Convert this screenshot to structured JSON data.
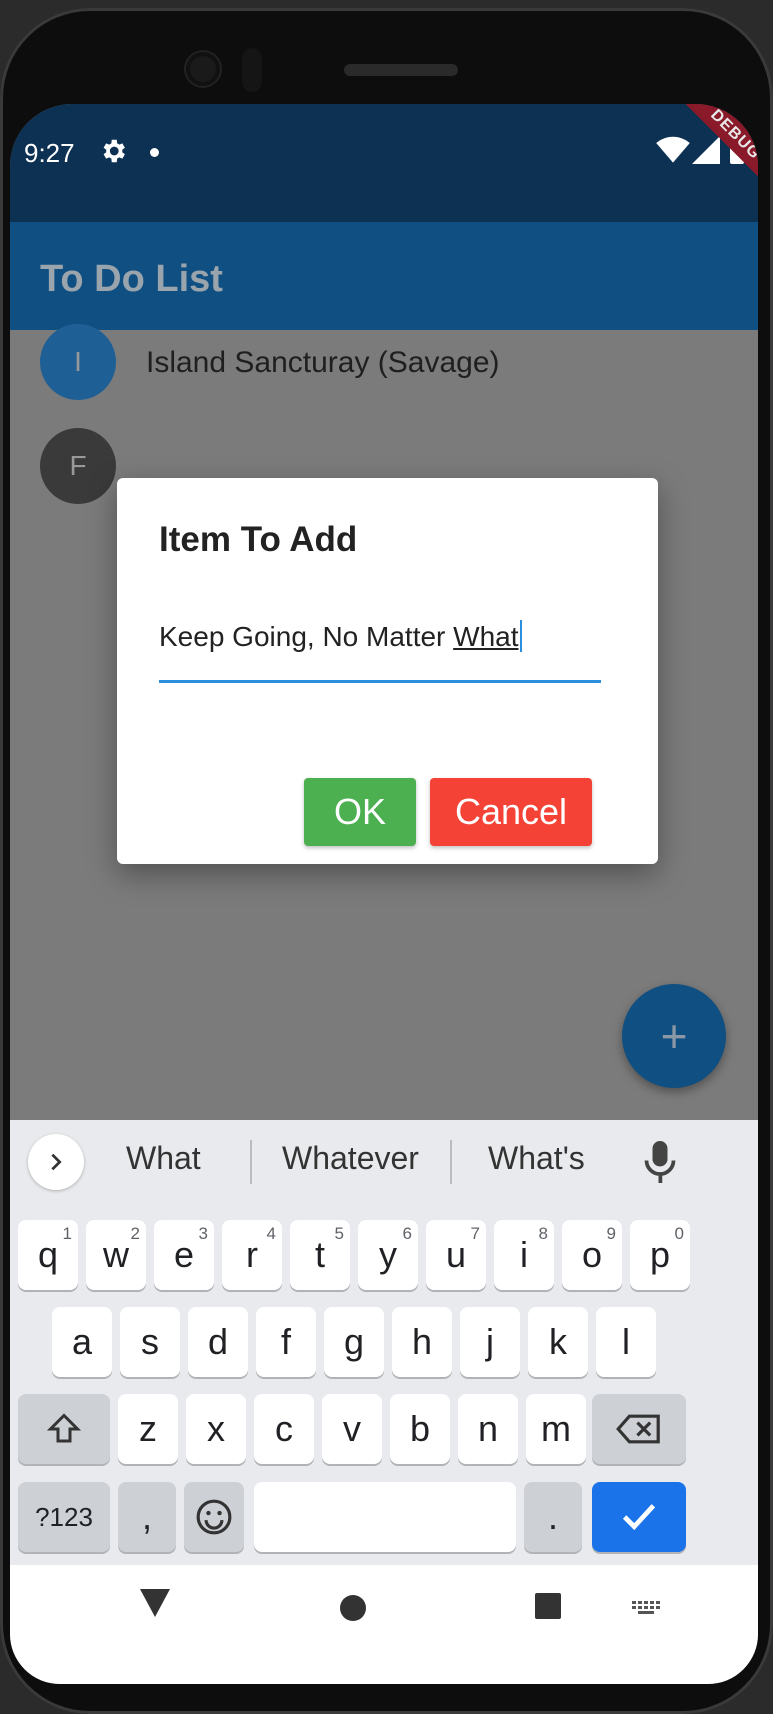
{
  "status_bar": {
    "time": "9:27",
    "debug_label": "DEBUG"
  },
  "app_bar": {
    "title": "To Do List"
  },
  "list": {
    "items": [
      {
        "initial": "I",
        "label": "Island Sancturay (Savage)",
        "avatar_color": "#1e5f96"
      },
      {
        "initial": "F",
        "label": "",
        "avatar_color": "#3a3a3a"
      }
    ]
  },
  "fab": {
    "label": "+"
  },
  "dialog": {
    "title": "Item To Add",
    "input_value_prefix": "Keep Going, No Matter ",
    "input_value_composing": "What",
    "ok_label": "OK",
    "cancel_label": "Cancel"
  },
  "keyboard": {
    "suggestions": [
      "What",
      "Whatever",
      "What's"
    ],
    "row1": [
      {
        "key": "q",
        "sup": "1"
      },
      {
        "key": "w",
        "sup": "2"
      },
      {
        "key": "e",
        "sup": "3"
      },
      {
        "key": "r",
        "sup": "4"
      },
      {
        "key": "t",
        "sup": "5"
      },
      {
        "key": "y",
        "sup": "6"
      },
      {
        "key": "u",
        "sup": "7"
      },
      {
        "key": "i",
        "sup": "8"
      },
      {
        "key": "o",
        "sup": "9"
      },
      {
        "key": "p",
        "sup": "0"
      }
    ],
    "row2": [
      "a",
      "s",
      "d",
      "f",
      "g",
      "h",
      "j",
      "k",
      "l"
    ],
    "row3": [
      "z",
      "x",
      "c",
      "v",
      "b",
      "n",
      "m"
    ],
    "symbols_label": "?123",
    "comma_label": ",",
    "period_label": "."
  },
  "colors": {
    "status_bar": "#0d3152",
    "app_bar": "#0f4f82",
    "ok": "#4caf50",
    "cancel": "#f44336",
    "accent": "#2b8fe0",
    "enter": "#1a73e8"
  }
}
